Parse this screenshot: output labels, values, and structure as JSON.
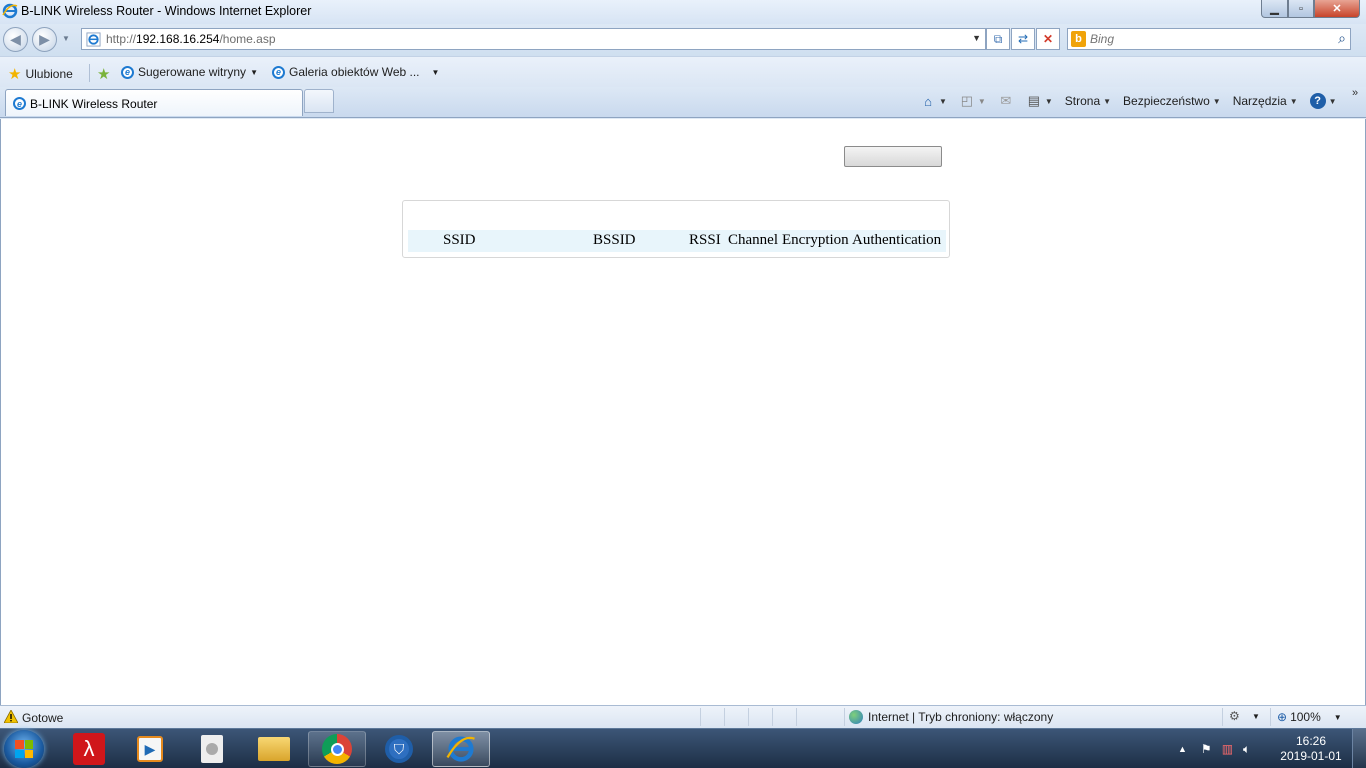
{
  "window": {
    "title": "B-LINK Wireless Router - Windows Internet Explorer"
  },
  "address_bar": {
    "url_prefix": "http://",
    "url_host": "192.168.16.254",
    "url_path": "/home.asp"
  },
  "search": {
    "placeholder": "Bing"
  },
  "favorites_bar": {
    "favorites_label": "Ulubione",
    "suggested_sites_label": "Sugerowane witryny",
    "web_slice_gallery_label": "Galeria obiektów Web ..."
  },
  "tabs": [
    {
      "label": "B-LINK Wireless Router",
      "active": true
    }
  ],
  "command_bar": {
    "page_label": "Strona",
    "safety_label": "Bezpieczeństwo",
    "tools_label": "Narzędzia"
  },
  "page": {
    "scan_table_headers": [
      "SSID",
      "BSSID",
      "RSSI",
      "Channel",
      "Encryption",
      "Authentication"
    ]
  },
  "status_bar": {
    "status_text": "Gotowe",
    "zone_text": "Internet | Tryb chroniony: włączony",
    "zoom_text": "100%"
  },
  "taskbar": {
    "apps": [
      "acrobat-reader-icon",
      "media-player-icon",
      "disc-burner-icon",
      "file-explorer-icon",
      "chrome-icon",
      "security-shield-icon",
      "internet-explorer-icon"
    ],
    "clock_time": "16:26",
    "clock_date": "2019-01-01"
  },
  "colors": {
    "table_header_bg": "#e8f5fb",
    "chrome_bg": "#dfe9f5",
    "taskbar_bg": "#1d2e45",
    "close_button": "#c7442a"
  }
}
